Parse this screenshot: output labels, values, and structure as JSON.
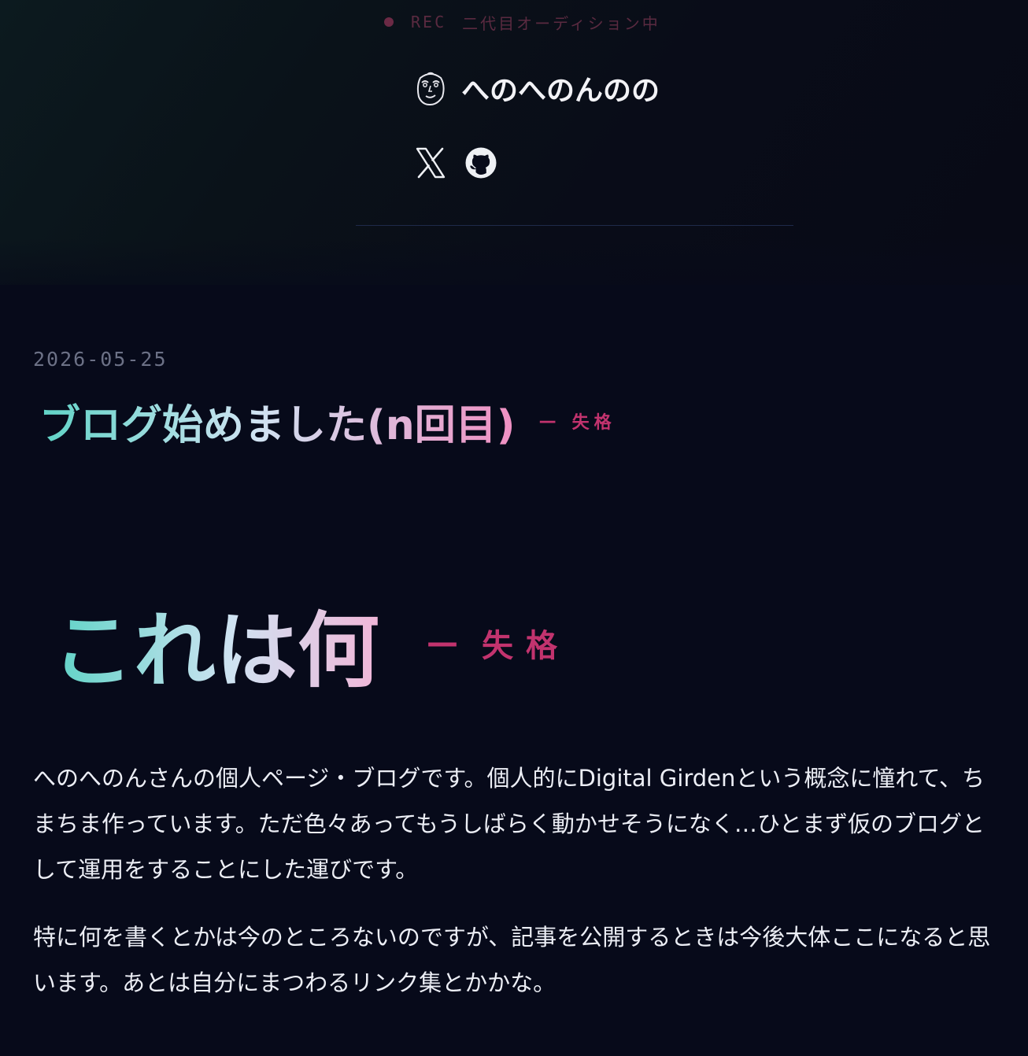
{
  "header": {
    "rec_label": "REC",
    "rec_status": "二代目オーディション中",
    "site_name": "へのへのんのの",
    "social": [
      {
        "name": "x-icon"
      },
      {
        "name": "github-icon"
      }
    ]
  },
  "post": {
    "date": "2026-05-25",
    "title": "ブログ始めました(n回目)",
    "tag_dash": "—",
    "tag": "失格"
  },
  "content": {
    "heading": "これは何",
    "heading_tag_dash": "—",
    "heading_tag": "失格",
    "paragraphs": [
      "へのへのんさんの個人ページ・ブログです。個人的にDigital Girdenという概念に憧れて、ちまちま作っています。ただ色々あってもうしばらく動かせそうになく…ひとまず仮のブログとして運用をすることにした運びです。",
      "特に何を書くとかは今のところないのですが、記事を公開するときは今後大体ここになると思います。あとは自分にまつわるリンク集とかかな。"
    ]
  },
  "colors": {
    "background": "#070a1a",
    "accent_pink": "#c2336e",
    "gradient_start": "#5fd3c6",
    "gradient_end": "#ef8fc2"
  }
}
